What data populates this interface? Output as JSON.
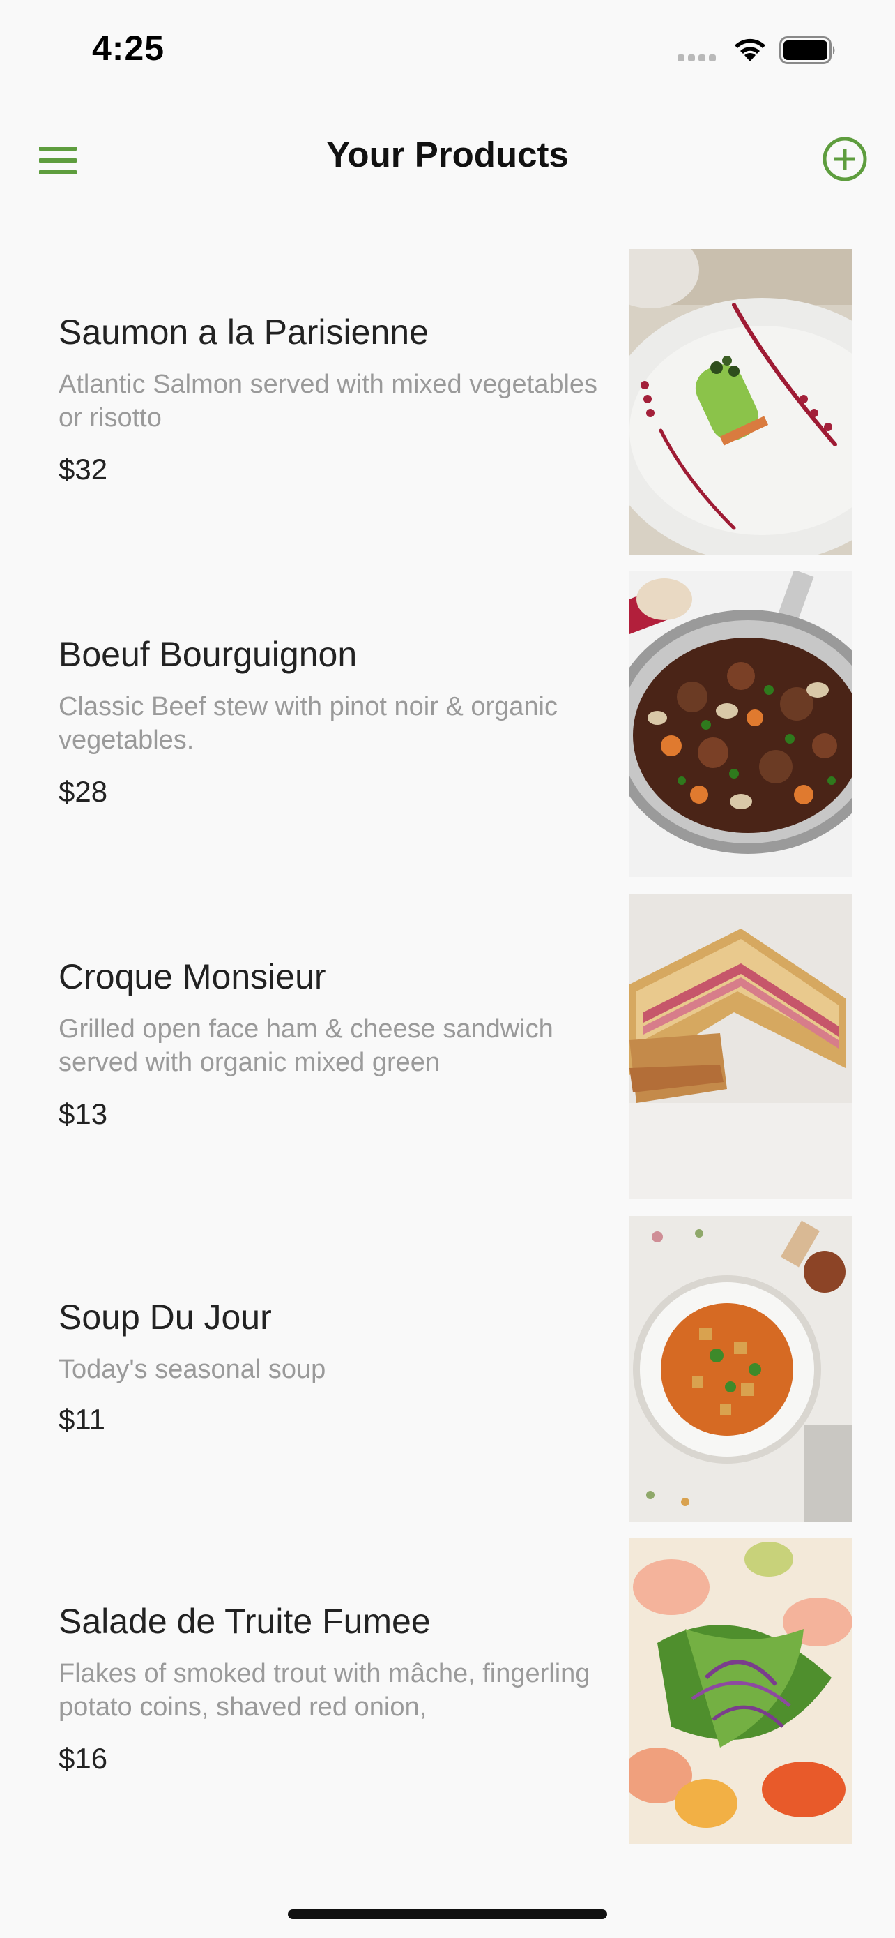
{
  "status_bar": {
    "time": "4:25"
  },
  "nav": {
    "title": "Your Products",
    "menu_icon": "hamburger-menu-icon",
    "add_icon": "plus-circle-icon",
    "accent_color": "#5e9d3e"
  },
  "products": [
    {
      "name": "Saumon a la Parisienne",
      "description": "Atlantic Salmon served with mixed vegetables or risotto",
      "price": "$32",
      "image": "salmon-dish-photo"
    },
    {
      "name": "Boeuf Bourguignon",
      "description": "Classic Beef stew with pinot noir & organic vegetables.",
      "price": "$28",
      "image": "beef-stew-pan-photo"
    },
    {
      "name": "Croque Monsieur",
      "description": "Grilled open face ham & cheese sandwich served with organic mixed green",
      "price": "$13",
      "image": "ham-cheese-sandwich-photo"
    },
    {
      "name": "Soup Du Jour",
      "description": "Today's seasonal soup",
      "price": "$11",
      "image": "tomato-soup-bowl-photo"
    },
    {
      "name": "Salade de Truite Fumee",
      "description": "Flakes of smoked trout with mâche, fingerling potato coins, shaved red onion,",
      "price": "$16",
      "image": "trout-salad-photo"
    }
  ]
}
